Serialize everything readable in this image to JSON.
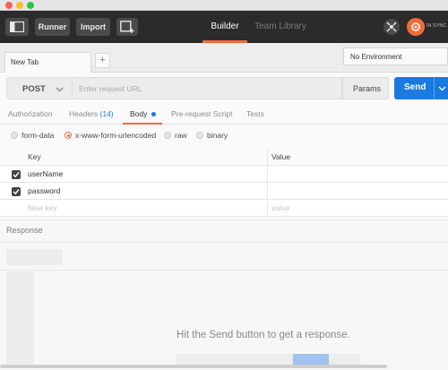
{
  "toolbar": {
    "runner_label": "Runner",
    "import_label": "Import",
    "builder_tab": "Builder",
    "team_library_tab": "Team Library",
    "sync_status": "IN SYNC"
  },
  "tabs": {
    "active_tab_label": "New Tab",
    "add_tab_symbol": "+"
  },
  "environment": {
    "selected": "No Environment"
  },
  "request": {
    "method": "POST",
    "url_placeholder": "Enter request URL",
    "params_label": "Params",
    "send_label": "Send"
  },
  "subtabs": {
    "authorization": "Authorization",
    "headers": "Headers",
    "headers_count": "(14)",
    "body": "Body",
    "pre_request": "Pre-request Script",
    "tests": "Tests"
  },
  "body_types": {
    "form_data": "form-data",
    "urlencoded": "x-www-form-urlencoded",
    "raw": "raw",
    "binary": "binary",
    "selected": "x-www-form-urlencoded"
  },
  "kv_table": {
    "key_header": "Key",
    "value_header": "Value",
    "rows": [
      {
        "key": "userName",
        "value": "",
        "checked": true
      },
      {
        "key": "password",
        "value": "",
        "checked": true
      }
    ],
    "new_key_placeholder": "New key",
    "new_value_placeholder": "value"
  },
  "response": {
    "title": "Response",
    "hint": "Hit the Send button to get a response."
  },
  "colors": {
    "accent_orange": "#f26b3a",
    "send_blue": "#1a7ae0",
    "toolbar_bg": "#2b2b2b"
  }
}
